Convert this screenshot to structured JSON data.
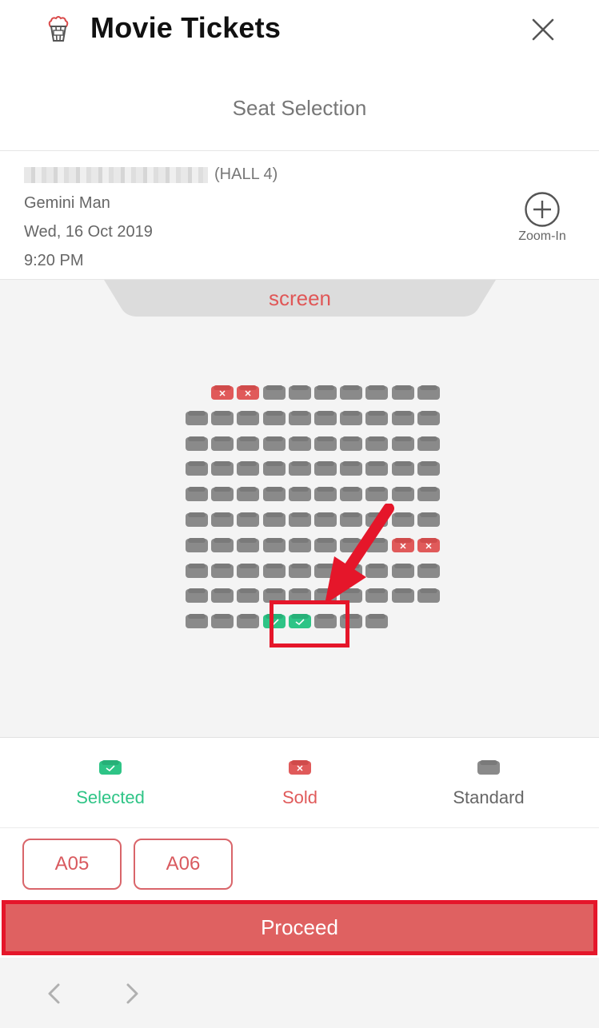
{
  "header": {
    "title": "Movie Tickets",
    "logo_icon": "popcorn-icon",
    "close_icon": "close-icon"
  },
  "page": {
    "title": "Seat Selection"
  },
  "info": {
    "hall": "(HALL 4)",
    "movie": "Gemini Man",
    "date": "Wed, 16 Oct 2019",
    "time": "9:20 PM",
    "zoom_label": "Zoom-In",
    "zoom_icon": "plus-circle-icon"
  },
  "seatmap": {
    "screen_label": "screen",
    "rows": [
      {
        "offset": 1,
        "seats": [
          "sold",
          "sold",
          "standard",
          "standard",
          "standard",
          "standard",
          "standard",
          "standard",
          "standard"
        ]
      },
      {
        "offset": 0,
        "seats": [
          "standard",
          "standard",
          "standard",
          "standard",
          "standard",
          "standard",
          "standard",
          "standard",
          "standard",
          "standard"
        ]
      },
      {
        "offset": 0,
        "seats": [
          "standard",
          "standard",
          "standard",
          "standard",
          "standard",
          "standard",
          "standard",
          "standard",
          "standard",
          "standard"
        ]
      },
      {
        "offset": 0,
        "seats": [
          "standard",
          "standard",
          "standard",
          "standard",
          "standard",
          "standard",
          "standard",
          "standard",
          "standard",
          "standard"
        ]
      },
      {
        "offset": 0,
        "seats": [
          "standard",
          "standard",
          "standard",
          "standard",
          "standard",
          "standard",
          "standard",
          "standard",
          "standard",
          "standard"
        ]
      },
      {
        "offset": 0,
        "seats": [
          "standard",
          "standard",
          "standard",
          "standard",
          "standard",
          "standard",
          "standard",
          "standard",
          "standard",
          "standard"
        ]
      },
      {
        "offset": 0,
        "seats": [
          "standard",
          "standard",
          "standard",
          "standard",
          "standard",
          "standard",
          "standard",
          "standard",
          "sold",
          "sold"
        ]
      },
      {
        "offset": 0,
        "seats": [
          "standard",
          "standard",
          "standard",
          "standard",
          "standard",
          "standard",
          "standard",
          "standard",
          "standard",
          "standard"
        ]
      },
      {
        "offset": 0,
        "seats": [
          "standard",
          "standard",
          "standard",
          "standard",
          "standard",
          "standard",
          "standard",
          "standard",
          "standard",
          "standard"
        ]
      },
      {
        "offset": 0,
        "seats": [
          "standard",
          "standard",
          "standard",
          "selected",
          "selected",
          "standard",
          "standard",
          "standard",
          "empty",
          "empty"
        ]
      }
    ]
  },
  "legend": {
    "selected": "Selected",
    "sold": "Sold",
    "standard": "Standard"
  },
  "selected_seats": [
    "A05",
    "A06"
  ],
  "proceed_label": "Proceed",
  "nav": {
    "back_icon": "chevron-left-icon",
    "forward_icon": "chevron-right-icon"
  },
  "colors": {
    "selected": "#2ec486",
    "sold": "#e05a5a",
    "standard": "#8a8a8a",
    "accent": "#df6161",
    "annotation": "#e5162a"
  }
}
